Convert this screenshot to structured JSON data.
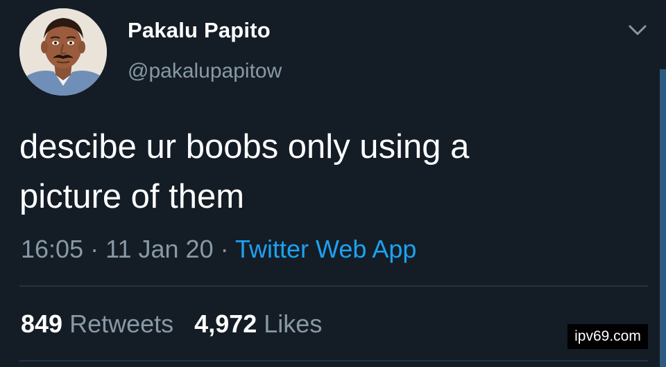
{
  "user": {
    "display_name": "Pakalu Papito",
    "handle": "@pakalupapitow"
  },
  "tweet": {
    "text_line1": "descibe ur boobs only using a",
    "text_line2": "picture of them",
    "time": "16:05",
    "date": "11 Jan 20",
    "separator": "·",
    "source": "Twitter Web App"
  },
  "stats": {
    "retweets_count": "849",
    "retweets_label": "Retweets",
    "likes_count": "4,972",
    "likes_label": "Likes"
  },
  "icons": {
    "menu": "chevron-down-icon",
    "avatar": "avatar"
  },
  "watermark": "ipv69.com",
  "colors": {
    "background": "#141d26",
    "secondary_text": "#8899a6",
    "link": "#1da1f2",
    "divider": "#253341"
  }
}
